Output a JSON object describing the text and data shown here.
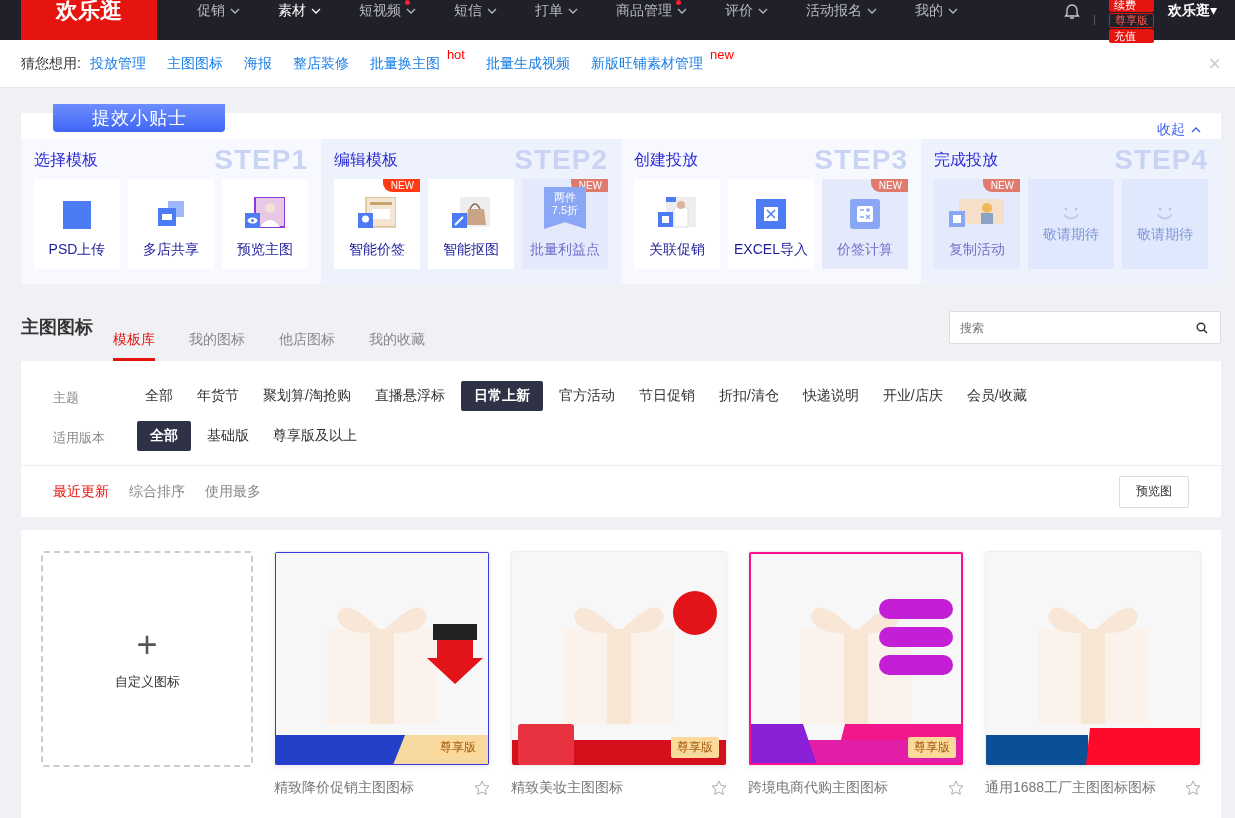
{
  "top_nav": {
    "logo": "欢乐逛",
    "items": [
      {
        "label": "促销",
        "selected": false,
        "dot": false
      },
      {
        "label": "素材",
        "selected": true,
        "dot": false
      },
      {
        "label": "短视频",
        "selected": false,
        "dot": true
      },
      {
        "label": "短信",
        "selected": false,
        "dot": false
      },
      {
        "label": "打单",
        "selected": false,
        "dot": false
      },
      {
        "label": "商品管理",
        "selected": false,
        "dot": true
      },
      {
        "label": "评价",
        "selected": false,
        "dot": false
      },
      {
        "label": "活动报名",
        "selected": false,
        "dot": false
      },
      {
        "label": "我的",
        "selected": false,
        "dot": false
      }
    ],
    "badges": [
      "续费",
      "尊享版",
      "充值"
    ],
    "user": "欢乐逛▾"
  },
  "suggest": {
    "label": "猜您想用:",
    "links": [
      {
        "label": "投放管理"
      },
      {
        "label": "主图图标"
      },
      {
        "label": "海报"
      },
      {
        "label": "整店装修"
      },
      {
        "label": "批量换主图",
        "tag": "hot"
      },
      {
        "label": "批量生成视频"
      },
      {
        "label": "新版旺铺素材管理",
        "tag": "new"
      }
    ],
    "close": "×"
  },
  "tips": {
    "ribbon": "提效小贴士",
    "collapse": "收起",
    "steps": [
      {
        "title": "选择模板",
        "step": "STEP1",
        "tiles": [
          {
            "kind": "tool",
            "label": "PSD上传",
            "disabled": false
          },
          {
            "kind": "tool",
            "label": "多店共享",
            "disabled": false
          },
          {
            "kind": "tool",
            "label": "预览主图",
            "disabled": false
          }
        ]
      },
      {
        "title": "编辑模板",
        "step": "STEP2",
        "tiles": [
          {
            "kind": "tool",
            "label": "智能价签",
            "new_badge": "NEW",
            "disabled": false
          },
          {
            "kind": "tool",
            "label": "智能抠图",
            "disabled": false
          },
          {
            "kind": "tool",
            "label": "批量利益点",
            "new_badge": "NEW",
            "disabled": true,
            "tag_text": "两件\n7.5折"
          }
        ]
      },
      {
        "title": "创建投放",
        "step": "STEP3",
        "tiles": [
          {
            "kind": "tool",
            "label": "关联促销",
            "disabled": false
          },
          {
            "kind": "tool",
            "label": "EXCEL导入",
            "disabled": false
          },
          {
            "kind": "tool",
            "label": "价签计算",
            "new_badge": "NEW",
            "disabled": true
          }
        ]
      },
      {
        "title": "完成投放",
        "step": "STEP4",
        "tiles": [
          {
            "kind": "tool",
            "label": "复制活动",
            "new_badge": "NEW",
            "disabled": true
          },
          {
            "kind": "soon",
            "label": "敬请期待"
          },
          {
            "kind": "soon",
            "label": "敬请期待"
          }
        ]
      }
    ]
  },
  "section": {
    "title": "主图图标",
    "tabs": [
      {
        "label": "模板库",
        "selected": true
      },
      {
        "label": "我的图标",
        "selected": false
      },
      {
        "label": "他店图标",
        "selected": false
      },
      {
        "label": "我的收藏",
        "selected": false
      }
    ],
    "search": {
      "placeholder": "搜索"
    }
  },
  "filters": [
    {
      "label": "主题",
      "options": [
        {
          "label": "全部",
          "selected": false
        },
        {
          "label": "年货节",
          "selected": false
        },
        {
          "label": "聚划算/淘抢购",
          "selected": false
        },
        {
          "label": "直播悬浮标",
          "selected": false
        },
        {
          "label": "日常上新",
          "selected": true
        },
        {
          "label": "官方活动",
          "selected": false
        },
        {
          "label": "节日促销",
          "selected": false
        },
        {
          "label": "折扣/清仓",
          "selected": false
        },
        {
          "label": "快递说明",
          "selected": false
        },
        {
          "label": "开业/店庆",
          "selected": false
        },
        {
          "label": "会员/收藏",
          "selected": false
        }
      ]
    },
    {
      "label": "适用版本",
      "options": [
        {
          "label": "全部",
          "selected": true
        },
        {
          "label": "基础版",
          "selected": false
        },
        {
          "label": "尊享版及以上",
          "selected": false
        }
      ]
    }
  ],
  "sort": {
    "options": [
      {
        "label": "最近更新",
        "selected": true
      },
      {
        "label": "综合排序",
        "selected": false
      },
      {
        "label": "使用最多",
        "selected": false
      }
    ],
    "preview_button": "预览图"
  },
  "grid": {
    "custom": {
      "plus": "+",
      "label": "自定义图标"
    },
    "templates": [
      {
        "name": "精致降价促销主图图标",
        "badge": "尊享版",
        "favorite": false
      },
      {
        "name": "精致美妆主图图标",
        "badge": "尊享版",
        "favorite": false
      },
      {
        "name": "跨境电商代购主图图标",
        "badge": "尊享版",
        "favorite": false
      },
      {
        "name": "通用1688工厂主图图标图标",
        "favorite": false
      }
    ]
  }
}
